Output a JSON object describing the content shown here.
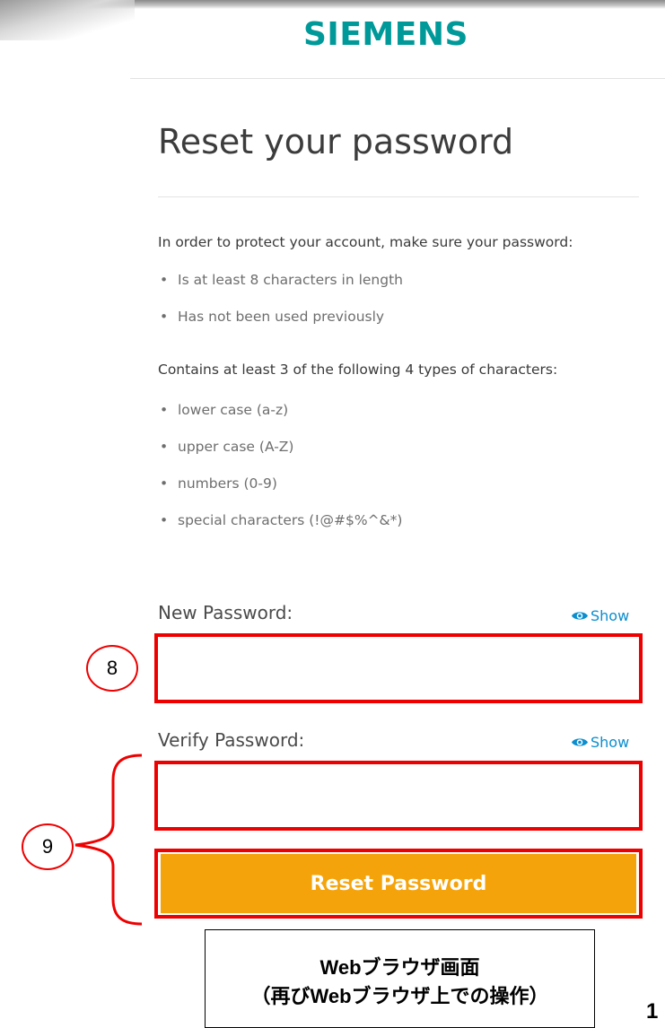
{
  "brand": {
    "logo_text": "SIEMENS",
    "color": "#009999"
  },
  "page": {
    "title": "Reset your password"
  },
  "requirements": {
    "intro": "In order to protect your account, make sure your password:",
    "items": [
      "Is at least 8 characters in length",
      "Has not been used previously"
    ],
    "intro2": "Contains at least 3 of the following 4 types of characters:",
    "char_types": [
      "lower case (a-z)",
      "upper case (A-Z)",
      "numbers (0-9)",
      "special characters (!@#$%^&*)"
    ]
  },
  "new_password": {
    "label": "New Password:",
    "show_label": "Show",
    "show_icon": "eye-icon",
    "value": ""
  },
  "verify_password": {
    "label": "Verify Password:",
    "show_label": "Show",
    "show_icon": "eye-icon",
    "value": ""
  },
  "submit": {
    "label": "Reset Password",
    "color": "#f5a30a"
  },
  "annotations": {
    "marker_new_password": "8",
    "marker_verify_and_submit": "9",
    "highlight_color": "#ee0000",
    "caption_line1": "Webブラウザ画面",
    "caption_line2": "（再びWebブラウザ上での操作）",
    "page_number": "1"
  }
}
